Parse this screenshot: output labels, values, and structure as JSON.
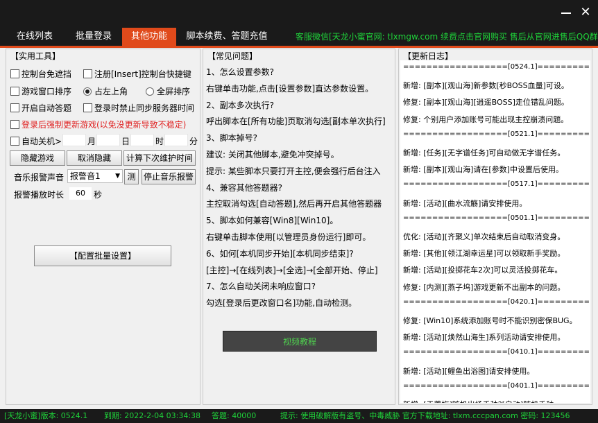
{
  "window": {
    "minimize_glyph": "—",
    "close_glyph": "✕"
  },
  "tabs": [
    {
      "label": "在线列表"
    },
    {
      "label": "批量登录"
    },
    {
      "label": "其他功能"
    },
    {
      "label": "脚本续费、答题充值"
    }
  ],
  "notice": "客服微信[天龙小蜜官网: tlxmgw.com 续费点击官网购买 售后从官网进售后QQ群]",
  "tools": {
    "title": "【实用工具】",
    "cb_console_no_cover": "控制台免遮挡",
    "cb_register_hotkey": "注册[Insert]控制台快捷键",
    "cb_sort_windows": "游戏窗口排序",
    "radio_top_left": "占左上角",
    "radio_full_screen": "全屏排序",
    "cb_auto_answer": "开启自动答题",
    "cb_disable_sync": "登录时禁止同步服务器时间",
    "cb_force_update": "登录后强制更新游戏(以免没更新导致不稳定)",
    "cb_auto_shutdown": "自动关机>",
    "unit_month": "月",
    "unit_day": "日",
    "unit_hour": "时",
    "unit_minute": "分",
    "btn_hide_game": "隐藏游戏",
    "btn_unhide": "取消隐藏",
    "btn_calc_maintenance": "计算下次维护时间",
    "music_alarm_label": "音乐报警声音",
    "music_select_value": "报警音1",
    "btn_test": "测",
    "btn_stop_music": "停止音乐报警",
    "alarm_duration_label": "报警播放时长",
    "alarm_duration_value": "60",
    "alarm_duration_unit": "秒",
    "btn_config_batch": "【配置批量设置】"
  },
  "faq": {
    "title": "【常见问题】",
    "lines": [
      "1、怎么设置参数?",
      "右键单击功能,点击[设置参数]直达参数设置。",
      "2、副本多次执行?",
      "呼出脚本在[所有功能]页取消勾选[副本单次执行]",
      "3、脚本掉号?",
      "建议: 关闭其他脚本,避免冲突掉号。",
      "提示: 某些脚本只要打开主控,便会强行后台注入",
      "4、兼容其他答题器?",
      "主控取消勾选[自动答题],然后再开启其他答题器",
      "5、脚本如何兼容[Win8][Win10]。",
      "右键单击脚本使用[以管理员身份运行]即可。",
      "6、如何[本机同步开始][本机同步结束]?",
      "[主控]→[在线列表]→[全选]→[全部开始、停止]",
      "7、怎么自动关闭未响应窗口?",
      "    勾选[登录后更改窗口名]功能,自动检测。"
    ],
    "video_button": "视频教程"
  },
  "changelog": {
    "title": "【更新日志】",
    "lines": [
      "==================[0524.1]==================",
      "新增: [副本][观山海]新参数[秒BOSS血量]可设。",
      "修复: [副本][观山海][逍遥BOSS]走位错乱问题。",
      "修复: 个别用户添加账号可能出现主控崩溃问题。",
      "==================[0521.1]==================",
      "新增: [任务][无字谱任务]可自动做无字谱任务。",
      "新增: [副本][观山海]请在[参数]中设置后使用。",
      "==================[0517.1]==================",
      "新增: [活动][曲水流觞]请安排使用。",
      "==================[0501.1]==================",
      "优化: [活动][齐聚义]单次结束后自动取消变身。",
      "新增: [其他][领江湖幸运星]可以领取新手奖励。",
      "新增: [活动][投掷花车2次]可以灵活投掷花车。",
      "修复: [内测][燕子坞]游戏更新不出副本的问题。",
      "==================[0420.1]==================",
      "修复: [Win10]系统添加账号时不能识别密保BUG。",
      "新增: [活动][焕然山海生]系列活动请安排使用。",
      "==================[0410.1]==================",
      "新增: [活动][鲤鱼出浴图]请安排使用。",
      "==================[0401.1]==================",
      "新增: [于蓉梅]随机出场千种?[自动]随机千种"
    ]
  },
  "status": {
    "version": "[天龙小蜜]版本: 0524.1",
    "expiry": "到期: 2022-2-04 03:34:38",
    "answers": "答题: 40000",
    "tip": "提示: 使用破解版有盗号、中毒威胁 官方下载地址: tlxm.cccpan.com 密码: 123456"
  }
}
